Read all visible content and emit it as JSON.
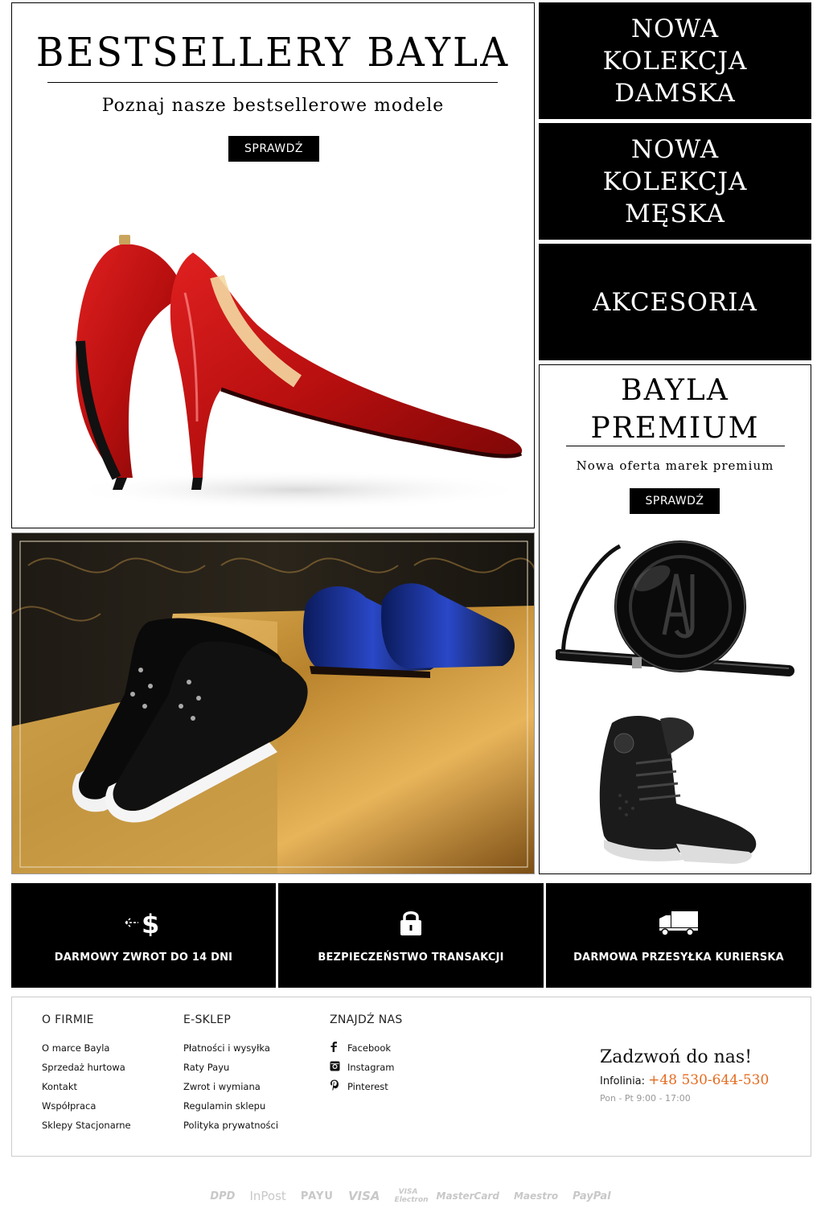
{
  "hero": {
    "title": "BESTSELLERY BAYLA",
    "subtitle": "Poznaj nasze bestsellerowe modele",
    "button": "SPRAWDŹ"
  },
  "tiles": {
    "women": "NOWA KOLEKCJA DAMSKA",
    "men": "NOWA KOLEKCJA MĘSKA",
    "accessories": "AKCESORIA"
  },
  "premium": {
    "title_line1": "BAYLA",
    "title_line2": "PREMIUM",
    "subtitle": "Nowa oferta marek premium",
    "button": "SPRAWDŹ"
  },
  "features": [
    {
      "label": "DARMOWY ZWROT DO 14 DNI",
      "icon": "dollar-return-icon"
    },
    {
      "label": "BEZPIECZEŃSTWO TRANSAKCJI",
      "icon": "lock-icon"
    },
    {
      "label": "DARMOWA PRZESYŁKA KURIERSKA",
      "icon": "truck-icon"
    }
  ],
  "footer": {
    "firm": {
      "title": "O FIRMIE",
      "links": [
        "O marce Bayla",
        "Sprzedaż hurtowa",
        "Kontakt",
        "Współpraca",
        "Sklepy Stacjonarne"
      ]
    },
    "shop": {
      "title": "E-SKLEP",
      "links": [
        "Płatności i wysyłka",
        "Raty Payu",
        "Zwrot i wymiana",
        "Regulamin sklepu",
        "Polityka prywatności"
      ]
    },
    "find": {
      "title": "ZNAJDŹ NAS",
      "links": [
        "Facebook",
        "Instagram",
        "Pinterest"
      ]
    },
    "call": {
      "title": "Zadzwoń do nas!",
      "label": "Infolinia:",
      "phone": "+48 530-644-530",
      "hours": "Pon - Pt  9:00 - 17:00"
    }
  },
  "payments": [
    "DPD",
    "InPost",
    "PAYU",
    "VISA",
    "VISA Electron",
    "MasterCard",
    "Maestro",
    "PayPal"
  ],
  "colors": {
    "accent": "#e46b1f",
    "black": "#000000"
  }
}
